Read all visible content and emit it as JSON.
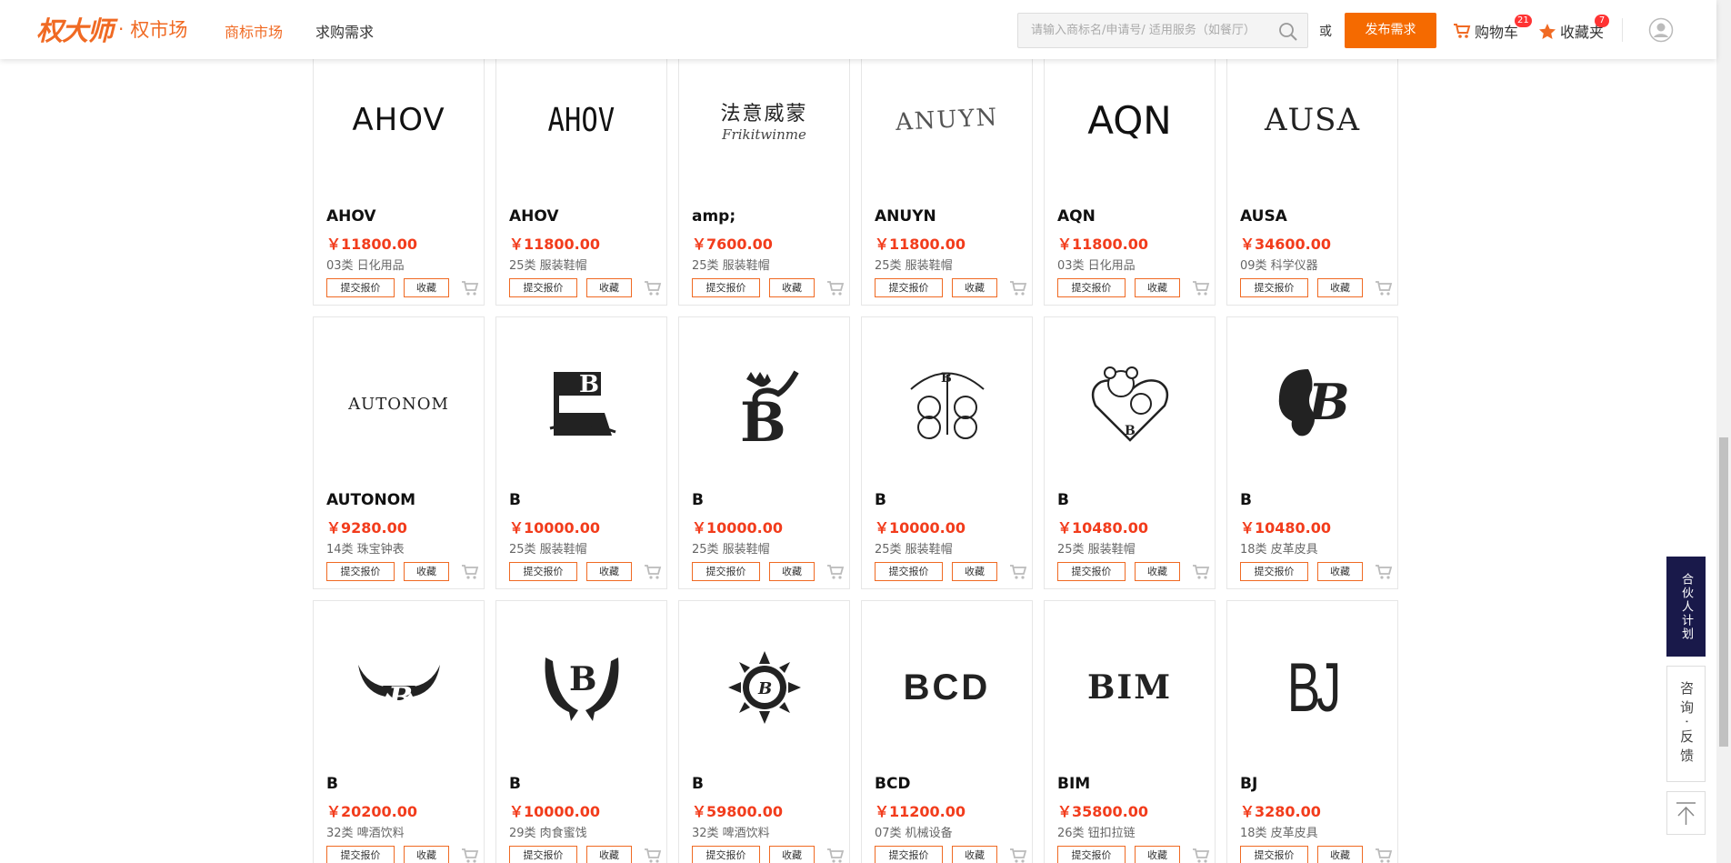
{
  "header": {
    "logo_script": "权大师",
    "logo_dot": "·",
    "logo_market": "权市场",
    "nav": [
      {
        "label": "商标市场",
        "active": true
      },
      {
        "label": "求购需求",
        "active": false
      }
    ],
    "search_placeholder": "请输入商标名/申请号/ 适用服务（如餐厅）",
    "or_text": "或",
    "publish_label": "发布需求",
    "cart_label": "购物车",
    "cart_count": "21",
    "fav_label": "收藏夹",
    "fav_count": "7"
  },
  "buttons": {
    "quote": "提交报价",
    "fav": "收藏"
  },
  "cards": [
    {
      "logo": "AHOV",
      "name": "AHOV",
      "price": "￥11800.00",
      "category": "03类 日化用品"
    },
    {
      "logo": "AHOV",
      "name": "AHOV",
      "price": "￥11800.00",
      "category": "25类 服装鞋帽"
    },
    {
      "logo": "法意威蒙",
      "logo_sub": "Frikitwinme",
      "name": "amp;",
      "price": "￥7600.00",
      "category": "25类 服装鞋帽"
    },
    {
      "logo": "ANUYN",
      "name": "ANUYN",
      "price": "￥11800.00",
      "category": "25类 服装鞋帽"
    },
    {
      "logo": "AQN",
      "name": "AQN",
      "price": "￥11800.00",
      "category": "03类 日化用品"
    },
    {
      "logo": "AUSA",
      "name": "AUSA",
      "price": "￥34600.00",
      "category": "09类 科学仪器"
    },
    {
      "logo": "AUTONOM",
      "name": "AUTONOM",
      "price": "￥9280.00",
      "category": "14类 珠宝钟表"
    },
    {
      "logo": "B",
      "name": "B",
      "price": "￥10000.00",
      "category": "25类 服装鞋帽"
    },
    {
      "logo": "B",
      "name": "B",
      "price": "￥10000.00",
      "category": "25类 服装鞋帽"
    },
    {
      "logo": "B",
      "name": "B",
      "price": "￥10000.00",
      "category": "25类 服装鞋帽"
    },
    {
      "logo": "B",
      "name": "B",
      "price": "￥10480.00",
      "category": "25类 服装鞋帽"
    },
    {
      "logo": "B",
      "name": "B",
      "price": "￥10480.00",
      "category": "18类 皮革皮具"
    },
    {
      "logo": "B",
      "name": "B",
      "price": "￥20200.00",
      "category": "32类 啤酒饮料"
    },
    {
      "logo": "B",
      "name": "B",
      "price": "￥10000.00",
      "category": "29类 肉食蜜饯"
    },
    {
      "logo": "B",
      "name": "B",
      "price": "￥59800.00",
      "category": "32类 啤酒饮料"
    },
    {
      "logo": "BCD",
      "name": "BCD",
      "price": "￥11200.00",
      "category": "07类 机械设备"
    },
    {
      "logo": "BIM",
      "name": "BIM",
      "price": "￥35800.00",
      "category": "26类 钮扣拉链"
    },
    {
      "logo": "BJ",
      "name": "BJ",
      "price": "￥3280.00",
      "category": "18类 皮革皮具"
    }
  ],
  "side": {
    "partner": "合伙人计划",
    "consult": "咨询·反馈"
  },
  "colors": {
    "accent": "#f06a23",
    "price": "#f23c1c",
    "partner_bg": "#19194a"
  }
}
